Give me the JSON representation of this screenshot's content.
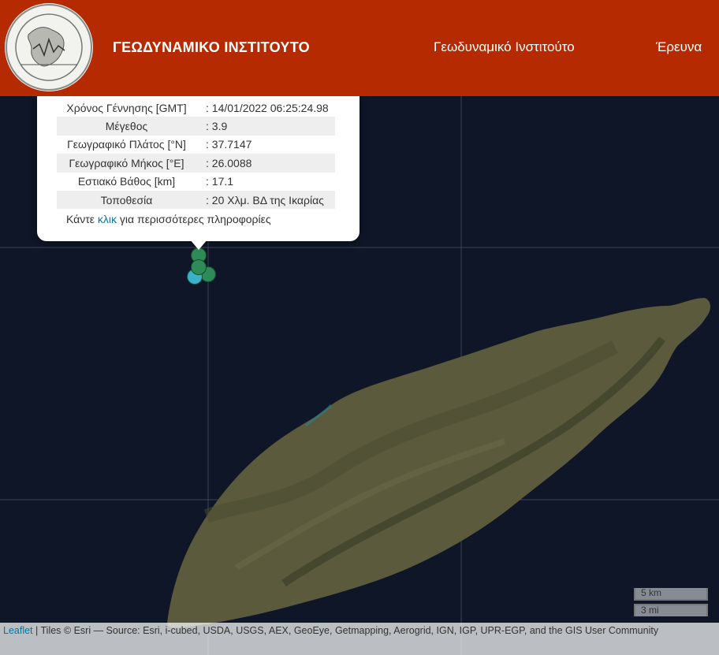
{
  "header": {
    "site_title": "ΓΕΩΔΥΝΑΜΙΚΟ ΙΝΣΤΙΤΟΥΤΟ",
    "nav": [
      "Γεωδυναμικό Ινστιτούτο",
      "Έρευνα"
    ],
    "background_color": "#b52a00",
    "logo_icon": "observatory-seal-logo"
  },
  "popup": {
    "rows": [
      {
        "key": "Χρόνος Γέννησης [GMT]",
        "value": ": 14/01/2022 06:25:24.98"
      },
      {
        "key": "Μέγεθος",
        "value": ": 3.9"
      },
      {
        "key": "Γεωγραφικό Πλάτος [°N]",
        "value": ": 37.7147"
      },
      {
        "key": "Γεωγραφικό Μήκος [°E]",
        "value": ": 26.0088"
      },
      {
        "key": "Εστιακό Βάθος [km]",
        "value": ": 17.1"
      },
      {
        "key": "Τοποθεσία",
        "value": ": 20 Χλμ. ΒΔ της Ικαρίας"
      }
    ],
    "more_prefix": "Κάντε ",
    "more_link": "κλικ",
    "more_suffix": " για περισσότερες πληροφορίες"
  },
  "map": {
    "scale_km": "5 km",
    "scale_mi": "3 mi",
    "sea_color": "#0e1627",
    "land_color": "#5b5a3c",
    "marker_colors": [
      "#2e8b57",
      "#3bb1c9"
    ]
  },
  "attribution": {
    "leaflet_link": "Leaflet",
    "text": " | Tiles © Esri — Source: Esri, i-cubed, USDA, USGS, AEX, GeoEye, Getmapping, Aerogrid, IGN, IGP, UPR-EGP, and the GIS User Community"
  }
}
